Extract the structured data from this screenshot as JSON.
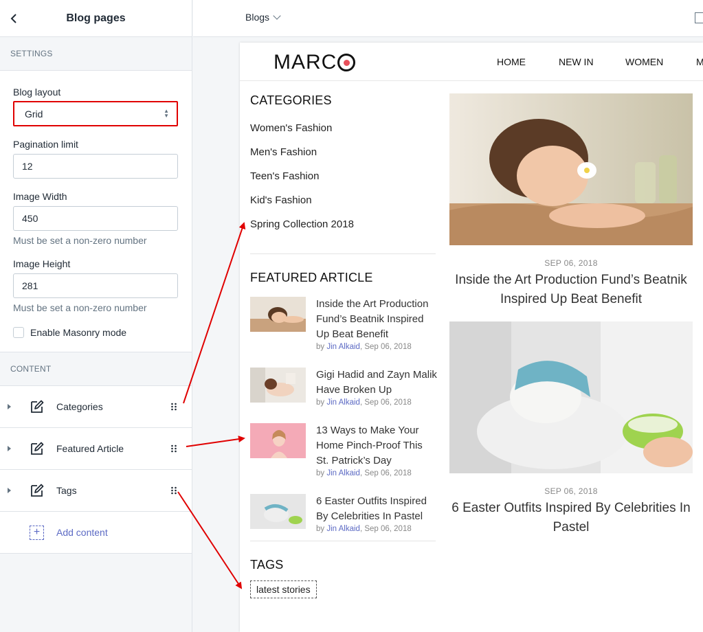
{
  "panel": {
    "title": "Blog pages",
    "settings_label": "SETTINGS",
    "blog_layout_label": "Blog layout",
    "blog_layout_value": "Grid",
    "pagination_label": "Pagination limit",
    "pagination_value": "12",
    "image_width_label": "Image Width",
    "image_width_value": "450",
    "image_width_help": "Must be set a non-zero number",
    "image_height_label": "Image Height",
    "image_height_value": "281",
    "image_height_help": "Must be set a non-zero number",
    "masonry_label": "Enable Masonry mode",
    "masonry_checked": false,
    "content_label": "CONTENT",
    "content_items": [
      {
        "label": "Categories"
      },
      {
        "label": "Featured Article"
      },
      {
        "label": "Tags"
      }
    ],
    "add_content_label": "Add content"
  },
  "topbar": {
    "blogs_label": "Blogs"
  },
  "store": {
    "logo_text": "MARC",
    "nav": [
      "HOME",
      "NEW IN",
      "WOMEN",
      "M"
    ],
    "categories_heading": "CATEGORIES",
    "categories": [
      "Women's Fashion",
      "Men's Fashion",
      "Teen's Fashion",
      "Kid's Fashion",
      "Spring Collection 2018"
    ],
    "featured_heading": "FEATURED ARTICLE",
    "featured": [
      {
        "title": "Inside the Art Production Fund’s Beatnik Inspired Up Beat Benefit",
        "by": "by ",
        "author": "Jin Alkaid",
        "date": ", Sep 06, 2018"
      },
      {
        "title": "Gigi Hadid and Zayn Malik Have Broken Up",
        "by": "by ",
        "author": "Jin Alkaid",
        "date": ", Sep 06, 2018"
      },
      {
        "title": "13 Ways to Make Your Home Pinch-Proof This St. Patrick’s Day",
        "by": "by ",
        "author": "Jin Alkaid",
        "date": ", Sep 06, 2018"
      },
      {
        "title": "6 Easter Outfits Inspired By Celebrities In Pastel",
        "by": "by ",
        "author": "Jin Alkaid",
        "date": ", Sep 06, 2018"
      }
    ],
    "tags_heading": "TAGS",
    "tags": [
      "latest stories"
    ],
    "posts": [
      {
        "date": "SEP 06, 2018",
        "title": "Inside the Art Production Fund’s Beatnik Inspired Up Beat Benefit"
      },
      {
        "date": "SEP 06, 2018",
        "title": "6 Easter Outfits Inspired By Celebrities In Pastel"
      }
    ]
  },
  "colors": {
    "accent": "#5c6ac4",
    "highlight_border": "#e00000",
    "annotation_arrow": "#e00000",
    "logo_dot": "#e8505b"
  }
}
